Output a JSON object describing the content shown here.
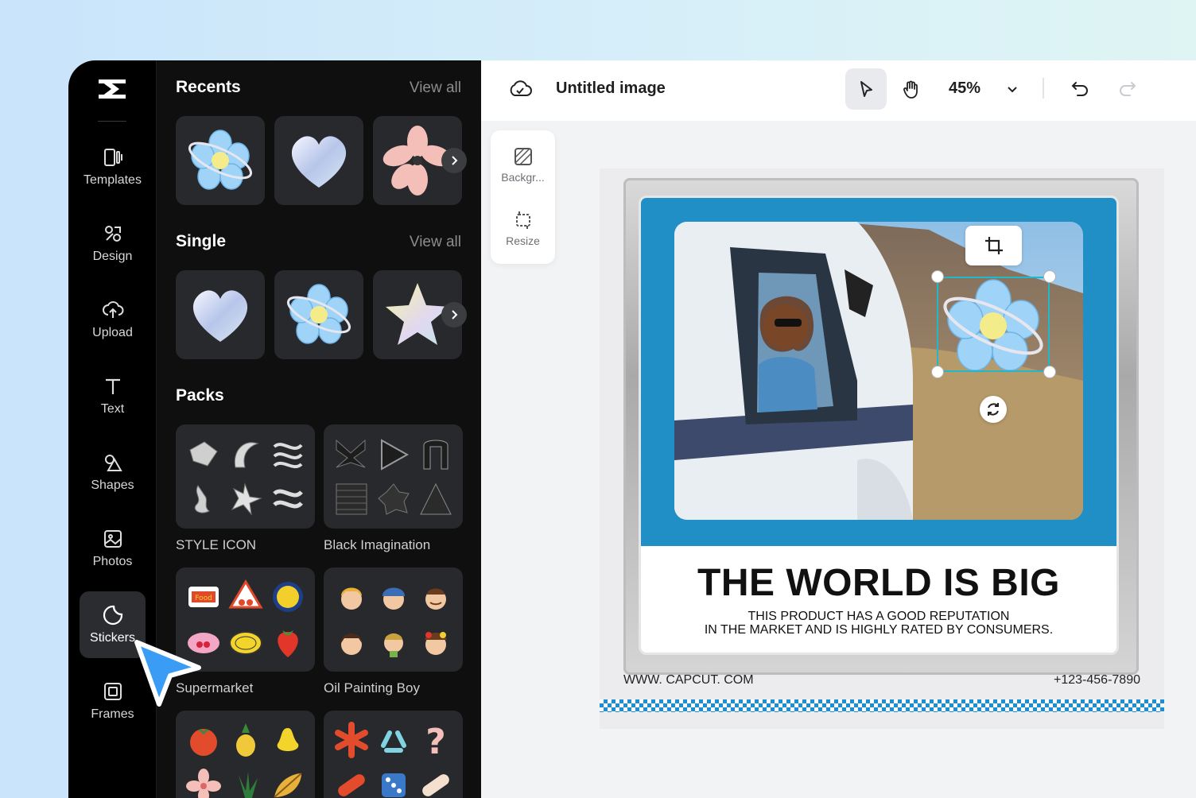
{
  "app": {
    "doc_title": "Untitled image",
    "zoom": "45%"
  },
  "rail": {
    "items": [
      {
        "label": "Templates",
        "icon": "templates-icon"
      },
      {
        "label": "Design",
        "icon": "design-icon"
      },
      {
        "label": "Upload",
        "icon": "upload-icon"
      },
      {
        "label": "Text",
        "icon": "text-icon"
      },
      {
        "label": "Shapes",
        "icon": "shapes-icon"
      },
      {
        "label": "Photos",
        "icon": "photos-icon"
      },
      {
        "label": "Stickers",
        "icon": "stickers-icon"
      },
      {
        "label": "Frames",
        "icon": "frames-icon"
      }
    ],
    "active": "Stickers"
  },
  "panel": {
    "recents": {
      "title": "Recents",
      "view_all": "View all"
    },
    "single": {
      "title": "Single",
      "view_all": "View all"
    },
    "packs": {
      "title": "Packs",
      "items": [
        "STYLE ICON",
        "Black Imagination",
        "Supermarket",
        "Oil Painting Boy"
      ]
    }
  },
  "float_tools": [
    {
      "label": "Backgr...",
      "icon": "background-icon"
    },
    {
      "label": "Resize",
      "icon": "resize-icon"
    }
  ],
  "poster": {
    "headline": "THE WORLD IS BIG",
    "sub_line1": "THIS PRODUCT HAS A GOOD    REPUTATION",
    "sub_line2": "IN THE MARKET AND IS HIGHLY RATED BY CONSUMERS.",
    "website": "WWW. CAPCUT. COM",
    "phone": "+123-456-7890"
  },
  "colors": {
    "accent": "#1f8fc5",
    "selection": "#22b8c9",
    "cursor": "#3b9cf5"
  }
}
